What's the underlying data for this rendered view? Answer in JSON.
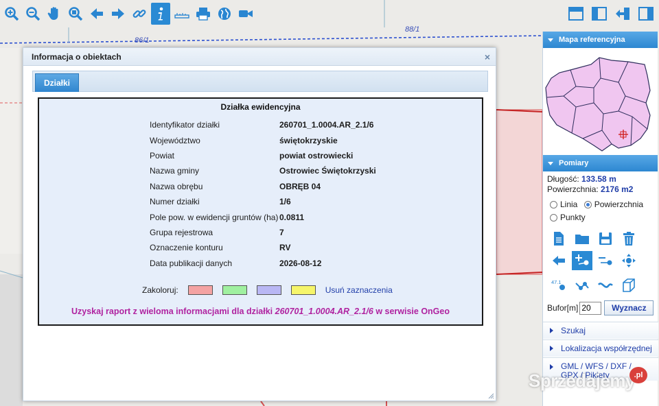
{
  "map": {
    "labels": [
      "86/1",
      "88/1"
    ]
  },
  "toolbar": {
    "tools": [
      {
        "icon": "zoom-in-icon"
      },
      {
        "icon": "zoom-out-icon"
      },
      {
        "icon": "pan-hand-icon"
      },
      {
        "icon": "zoom-extent-icon"
      },
      {
        "icon": "back-arrow-icon"
      },
      {
        "icon": "forward-arrow-icon"
      },
      {
        "icon": "link-icon"
      },
      {
        "icon": "info-icon",
        "active": true
      },
      {
        "icon": "ruler-icon"
      },
      {
        "icon": "print-icon"
      },
      {
        "icon": "globe-icon"
      },
      {
        "icon": "video-camera-icon"
      }
    ],
    "right_tools": [
      {
        "icon": "layout-top-icon"
      },
      {
        "icon": "layout-left-icon"
      },
      {
        "icon": "export-arrow-icon"
      },
      {
        "icon": "layout-right-icon"
      }
    ]
  },
  "dialog": {
    "title": "Informacja o obiektach",
    "close": "×",
    "tab": "Działki",
    "panel_title": "Działka ewidencyjna",
    "rows": [
      {
        "label": "Identyfikator działki",
        "value": "260701_1.0004.AR_2.1/6"
      },
      {
        "label": "Województwo",
        "value": "świętokrzyskie"
      },
      {
        "label": "Powiat",
        "value": "powiat ostrowiecki"
      },
      {
        "label": "Nazwa gminy",
        "value": "Ostrowiec Świętokrzyski"
      },
      {
        "label": "Nazwa obrębu",
        "value": "OBRĘB 04"
      },
      {
        "label": "Numer działki",
        "value": "1/6"
      },
      {
        "label": "Pole pow. w ewidencji gruntów (ha)",
        "value": "0.0811"
      },
      {
        "label": "Grupa rejestrowa",
        "value": "7"
      },
      {
        "label": "Oznaczenie konturu",
        "value": "RV"
      },
      {
        "label": "Data publikacji danych",
        "value": "2026-08-12"
      }
    ],
    "colorize_label": "Zakoloruj:",
    "swatches": [
      "#f4a3a3",
      "#a0f0a0",
      "#b9b7f4",
      "#f6f56a"
    ],
    "clear_label": "Usuń zaznaczenia",
    "report_prefix": "Uzyskaj raport z wieloma informacjami dla działki",
    "report_id": "260701_1.0004.AR_2.1/6",
    "report_suffix": "w serwisie OnGeo"
  },
  "sidebar": {
    "ref_header": "Mapa referencyjna",
    "measure_header": "Pomiary",
    "length_label": "Długość:",
    "length_value": "133.58 m",
    "area_label": "Powierzchnia:",
    "area_value": "2176 m2",
    "mode_linia": "Linia",
    "mode_powierzchnia": "Powierzchnia",
    "mode_punkty": "Punkty",
    "mode_selected": "Powierzchnia",
    "point_label": "47.1",
    "buffer_label": "Bufor[m]",
    "buffer_value": "20",
    "buffer_button": "Wyznacz",
    "links": [
      "Szukaj",
      "Lokalizacja współrzędnej",
      "GML / WFS / DXF / GPX / Pikiety"
    ]
  },
  "watermark": {
    "text": "Sprzedajemy",
    "badge": ".pl"
  }
}
